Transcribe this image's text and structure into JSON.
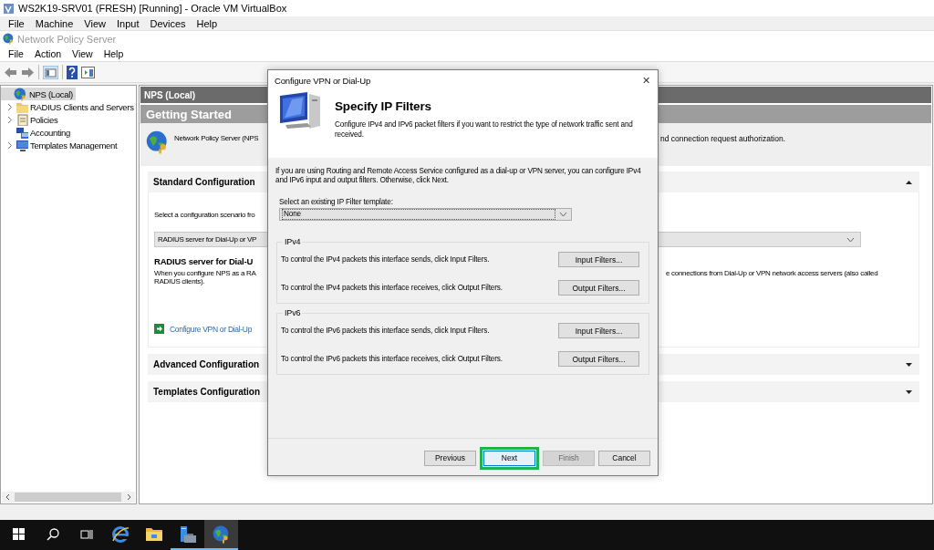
{
  "window": {
    "title": "WS2K19-SRV01 (FRESH) [Running] - Oracle VM VirtualBox"
  },
  "vm_menu": [
    "File",
    "Machine",
    "View",
    "Input",
    "Devices",
    "Help"
  ],
  "app": {
    "title": "Network Policy Server",
    "menu": [
      "File",
      "Action",
      "View",
      "Help"
    ]
  },
  "tree": [
    {
      "label": "NPS (Local)",
      "kind": "globe",
      "selected": true,
      "expandable": false,
      "children": [
        {
          "label": "RADIUS Clients and Servers",
          "kind": "folder",
          "selected": false,
          "expandable": true
        },
        {
          "label": "Policies",
          "kind": "scroll",
          "selected": false,
          "expandable": true
        },
        {
          "label": "Accounting",
          "kind": "computers",
          "selected": false,
          "expandable": false
        },
        {
          "label": "Templates Management",
          "kind": "monitor",
          "selected": false,
          "expandable": true
        }
      ]
    }
  ],
  "content": {
    "header": "NPS (Local)",
    "banner": "Getting Started",
    "description_start": "Network Policy Server (NPS",
    "description_end": "nd connection request authorization.",
    "sections": [
      {
        "title": "Standard Configuration",
        "expanded": true,
        "prompt": "Select a configuration scenario fro",
        "scenario": "RADIUS server for Dial-Up or VP",
        "heading": "RADIUS server for Dial-U",
        "text_left": [
          "When you configure NPS as a RA",
          "RADIUS clients)."
        ],
        "text_right": "e connections from Dial-Up or VPN network access servers (also called",
        "link": "Configure VPN or Dial-Up"
      },
      {
        "title": "Advanced Configuration",
        "expanded": false
      },
      {
        "title": "Templates Configuration",
        "expanded": false
      }
    ]
  },
  "dialog": {
    "title": "Configure VPN or Dial-Up",
    "close": "✕",
    "heading": "Specify IP Filters",
    "subtitle": "Configure IPv4 and IPv6 packet filters if you want to restrict the type of network traffic sent and received.",
    "intro": "If you are using Routing and Remote Access Service configured as a dial-up or VPN server, you can configure IPv4 and IPv6 input and output filters. Otherwise, click Next.",
    "template_label": "Select an existing IP Filter template:",
    "template_value": "None",
    "groups": [
      {
        "title": "IPv4",
        "rows": [
          {
            "text": "To control the IPv4 packets this interface sends, click Input Filters.",
            "button": "Input Filters..."
          },
          {
            "text": "To control the IPv4 packets this interface receives, click Output Filters.",
            "button": "Output Filters..."
          }
        ]
      },
      {
        "title": "IPv6",
        "rows": [
          {
            "text": "To control the IPv6 packets this interface sends, click Input Filters.",
            "button": "Input Filters..."
          },
          {
            "text": "To control the IPv6 packets this interface receives, click Output Filters.",
            "button": "Output Filters..."
          }
        ]
      }
    ],
    "buttons": [
      {
        "label": "Previous",
        "disabled": false,
        "highlighted": false
      },
      {
        "label": "Next",
        "disabled": false,
        "highlighted": true
      },
      {
        "label": "Finish",
        "disabled": true,
        "highlighted": false
      },
      {
        "label": "Cancel",
        "disabled": false,
        "highlighted": false
      }
    ]
  },
  "taskbar": [
    {
      "kind": "start",
      "selected": false,
      "running": false
    },
    {
      "kind": "search",
      "selected": false,
      "running": false
    },
    {
      "kind": "taskview",
      "selected": false,
      "running": false
    },
    {
      "kind": "browser",
      "selected": false,
      "running": false
    },
    {
      "kind": "folder",
      "selected": false,
      "running": false
    },
    {
      "kind": "server",
      "selected": false,
      "running": true
    },
    {
      "kind": "globe",
      "selected": true,
      "running": true
    }
  ]
}
